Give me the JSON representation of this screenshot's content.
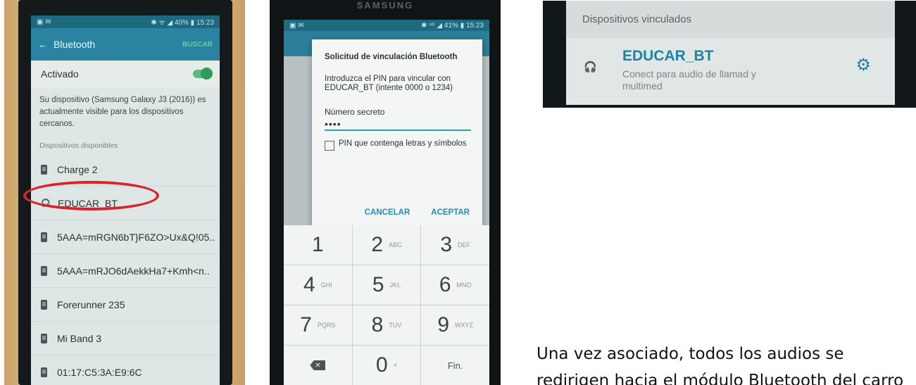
{
  "photo1": {
    "status": {
      "left": "▣ ✉",
      "right": "✱ ᯤ ◢ 40% ▮ 15:23"
    },
    "appbar": {
      "back": "←",
      "title": "Bluetooth",
      "action": "BUSCAR"
    },
    "activado": "Activado",
    "description": "Su dispositivo (Samsung Galaxy J3 (2016)) es actualmente visible para los dispositivos cercanos.",
    "section": "Dispositivos disponibles",
    "devices": [
      {
        "name": "Charge 2",
        "icon": "phone-icon"
      },
      {
        "name": "EDUCAR_BT",
        "icon": "headset-icon"
      },
      {
        "name": "5AAA=mRGN6bT}F6ZO>Ux&Q!05..",
        "icon": "phone-icon"
      },
      {
        "name": "5AAA=mRJO6dAekkHa7+Kmh<n..",
        "icon": "phone-icon"
      },
      {
        "name": "Forerunner 235",
        "icon": "phone-icon"
      },
      {
        "name": "Mi Band 3",
        "icon": "phone-icon"
      },
      {
        "name": "01:17:C5:3A:E9:6C",
        "icon": "phone-icon"
      }
    ],
    "highlight_color": "#d6262b"
  },
  "photo2": {
    "brand": "SAMSUNG",
    "status": {
      "left": "▣ ✉",
      "right": "✱ ⁴⁶ ◢ 41% ▮ 15:23"
    },
    "dialog": {
      "title": "Solicitud de vinculación Bluetooth",
      "message": "Introduzca el PIN para vincular con EDUCAR_BT (intente 0000 o 1234)",
      "field_label": "Número secreto",
      "field_value": "••••",
      "checkbox_label": "PIN que contenga letras y símbolos",
      "cancel": "CANCELAR",
      "accept": "ACEPTAR"
    },
    "keypad": [
      {
        "digit": "1",
        "letters": ""
      },
      {
        "digit": "2",
        "letters": "ABC"
      },
      {
        "digit": "3",
        "letters": "DEF"
      },
      {
        "digit": "4",
        "letters": "GHI"
      },
      {
        "digit": "5",
        "letters": "JKL"
      },
      {
        "digit": "6",
        "letters": "MNO"
      },
      {
        "digit": "7",
        "letters": "PQRS"
      },
      {
        "digit": "8",
        "letters": "TUV"
      },
      {
        "digit": "9",
        "letters": "WXYZ"
      },
      {
        "digit": "✕",
        "letters": ""
      },
      {
        "digit": "0",
        "letters": "+"
      },
      {
        "digit": "Fin.",
        "letters": ""
      }
    ]
  },
  "photo3": {
    "header": "Dispositivos vinculados",
    "device_name": "EDUCAR_BT",
    "device_sub": "Conect para audio de llamad y multimed",
    "accent": "#1e82a6"
  },
  "caption": {
    "line1": "Una vez asociado, todos los audios se",
    "line2": "redirigen hacia el módulo Bluetooth del carro"
  }
}
